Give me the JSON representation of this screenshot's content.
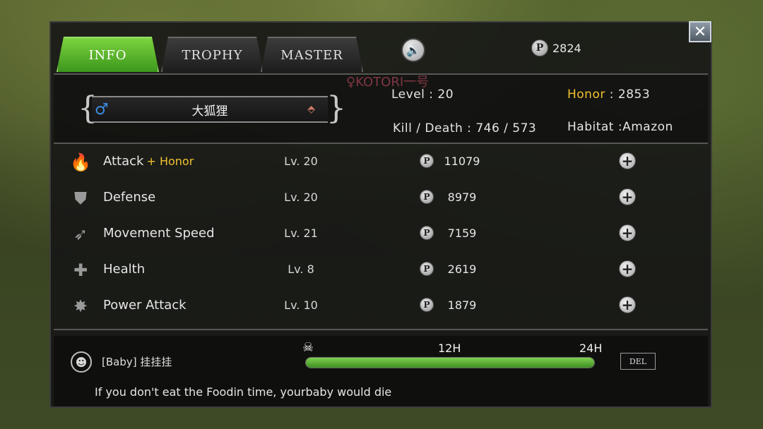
{
  "tabs": [
    {
      "label": "INFO",
      "active": true
    },
    {
      "label": "TROPHY",
      "active": false
    },
    {
      "label": "MASTER",
      "active": false
    }
  ],
  "header": {
    "points": "2824",
    "sound_icon": "speaker-icon",
    "close_icon": "close-icon",
    "faded_player_name": "♀KOTORI一号"
  },
  "profile": {
    "pet_name": "大狐狸",
    "gender_symbol": "♂",
    "level_label": "Level",
    "level_value": "20",
    "honor_label": "Honor",
    "honor_value": "2853",
    "kd_label": "Kill / Death",
    "kd_value": "746 / 573",
    "habitat_label": "Habitat",
    "habitat_value": "Amazon"
  },
  "stats": [
    {
      "icon": "flame-icon",
      "name": "Attack",
      "bonus": "+ Honor",
      "level": "Lv. 20",
      "cost": "11079"
    },
    {
      "icon": "shield-icon",
      "name": "Defense",
      "bonus": "",
      "level": "Lv. 20",
      "cost": "8979"
    },
    {
      "icon": "wing-icon",
      "name": "Movement Speed",
      "bonus": "",
      "level": "Lv. 21",
      "cost": "7159"
    },
    {
      "icon": "cross-icon",
      "name": "Health",
      "bonus": "",
      "level": "Lv. 8",
      "cost": "2619"
    },
    {
      "icon": "burst-icon",
      "name": "Power Attack",
      "bonus": "",
      "level": "Lv. 10",
      "cost": "1879"
    }
  ],
  "baby": {
    "label": "[Baby]  挂挂挂",
    "time_12": "12H",
    "time_24": "24H",
    "progress": 1.0,
    "del_label": "DEL",
    "hint": "If you don't eat the Foodin time, yourbaby would die"
  },
  "colors": {
    "active_tab": "#5cb82e",
    "gold_text": "#f0c132",
    "male_blue": "#3b8be0",
    "bar_green": "#66c23a"
  }
}
